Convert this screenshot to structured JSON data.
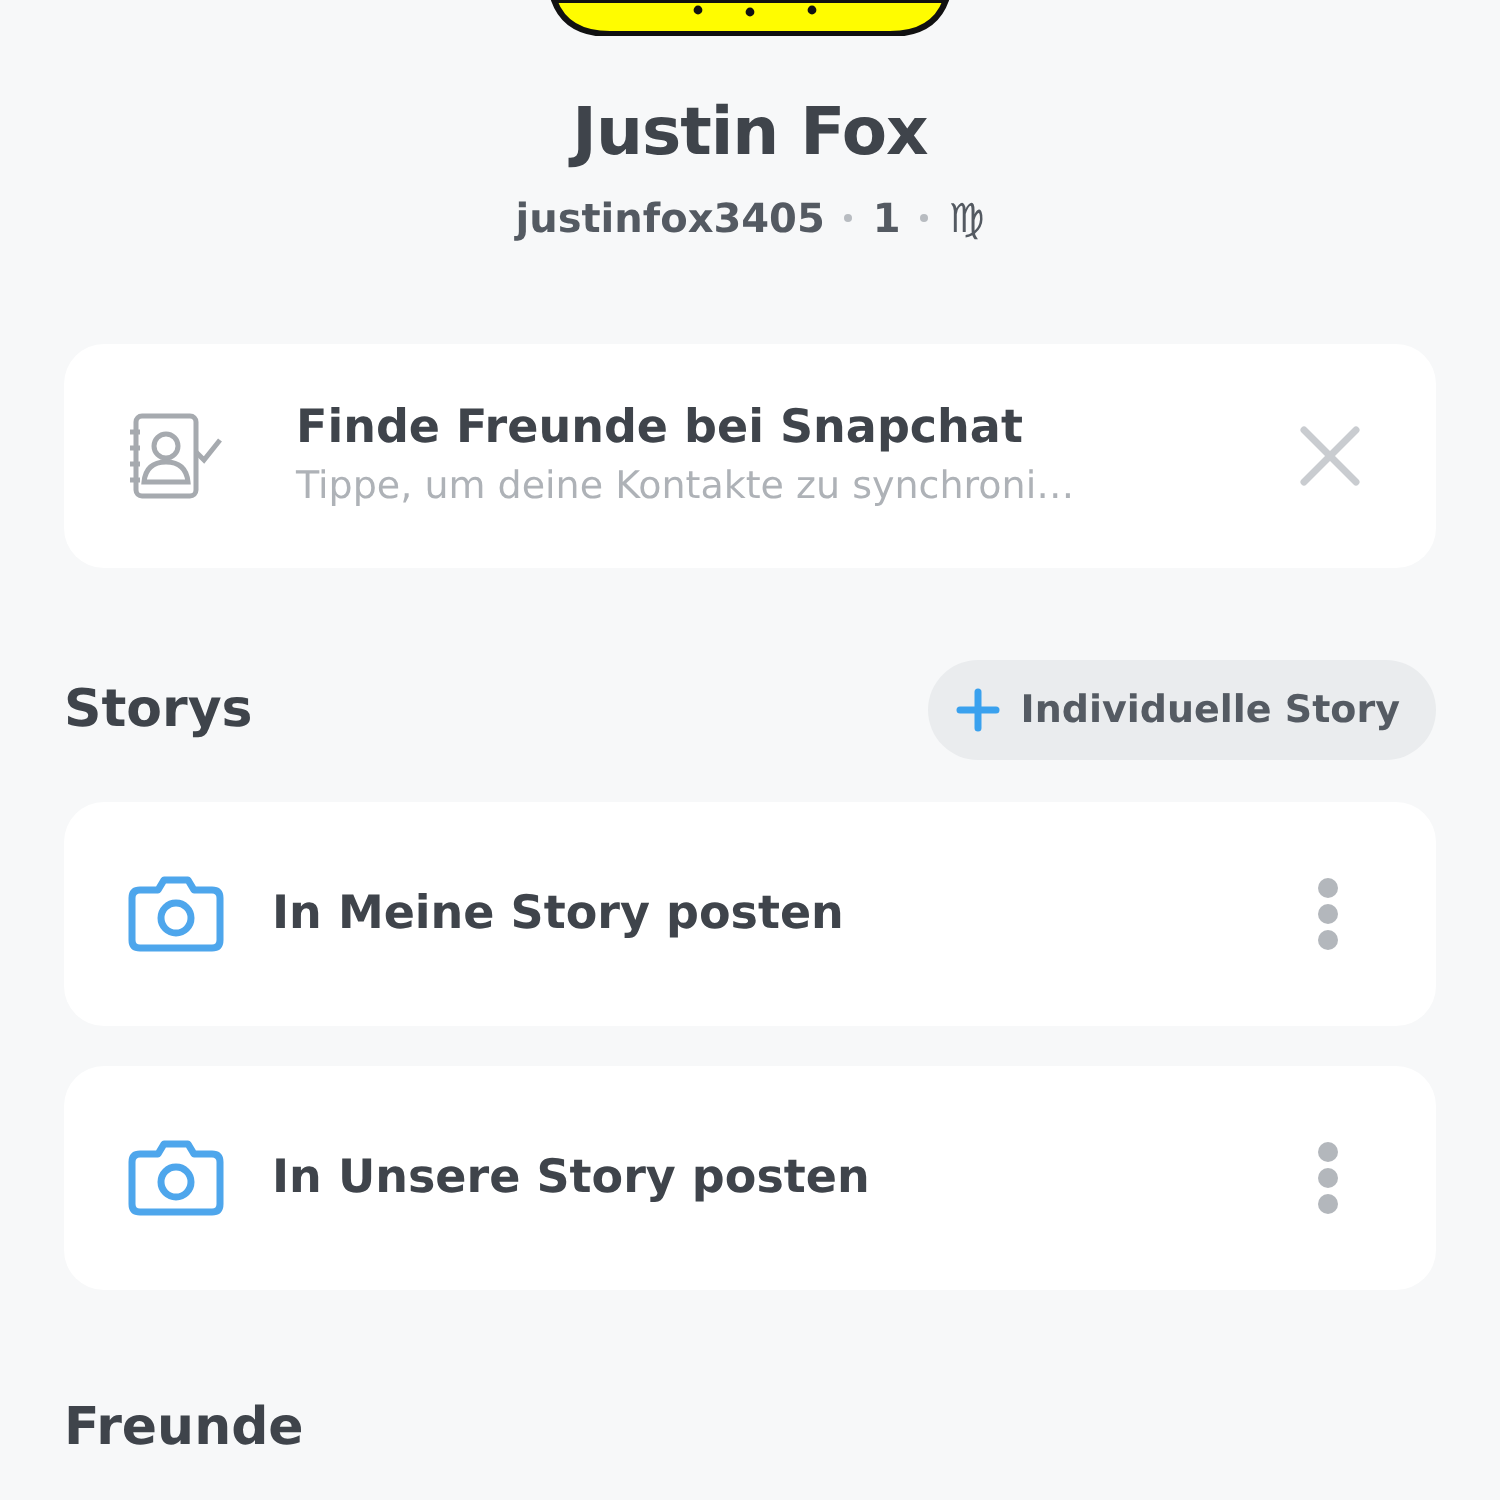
{
  "profile": {
    "name": "Justin Fox",
    "username": "justinfox3405",
    "score": "1",
    "zodiac": "♍"
  },
  "find_friends": {
    "title": "Finde Freunde bei Snapchat",
    "subtitle": "Tippe, um deine Kontakte zu synchroni…"
  },
  "stories": {
    "heading": "Storys",
    "add_button": "Individuelle Story",
    "items": [
      {
        "label": "In Meine Story posten"
      },
      {
        "label": "In Unsere Story posten"
      }
    ]
  },
  "friends": {
    "heading": "Freunde"
  }
}
